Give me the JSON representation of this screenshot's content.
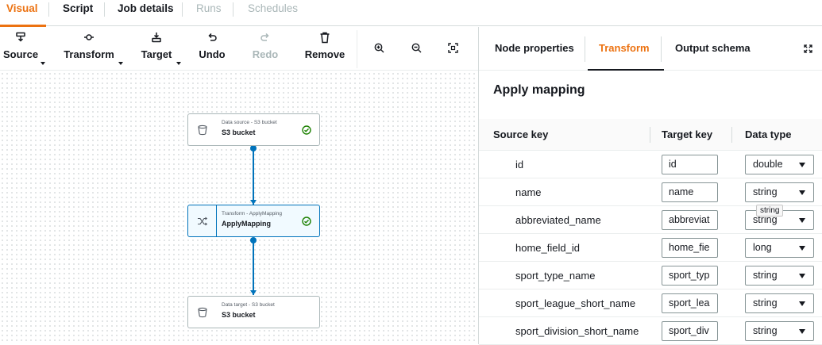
{
  "top_tabs": [
    {
      "label": "Visual"
    },
    {
      "label": "Script"
    },
    {
      "label": "Job details"
    },
    {
      "label": "Runs"
    },
    {
      "label": "Schedules"
    }
  ],
  "toolbar": {
    "source": "Source",
    "transform": "Transform",
    "target": "Target",
    "undo": "Undo",
    "redo": "Redo",
    "remove": "Remove"
  },
  "nodes": [
    {
      "subtitle": "Data source - S3 bucket",
      "title": "S3 bucket",
      "status": "success"
    },
    {
      "subtitle": "Transform - ApplyMapping",
      "title": "ApplyMapping",
      "status": "success"
    },
    {
      "subtitle": "Data target - S3 bucket",
      "title": "S3 bucket"
    }
  ],
  "panel": {
    "tabs": [
      {
        "label": "Node properties"
      },
      {
        "label": "Transform"
      },
      {
        "label": "Output schema"
      }
    ],
    "title": "Apply mapping",
    "columns": {
      "source_key": "Source key",
      "target_key": "Target key",
      "data_type": "Data type"
    },
    "rows": [
      {
        "source": "id",
        "target": "id",
        "type": "double"
      },
      {
        "source": "name",
        "target": "name",
        "type": "string"
      },
      {
        "source": "abbreviated_name",
        "target": "abbreviat",
        "type": "string"
      },
      {
        "source": "home_field_id",
        "target": "home_fie",
        "type": "long"
      },
      {
        "source": "sport_type_name",
        "target": "sport_typ",
        "type": "string"
      },
      {
        "source": "sport_league_short_name",
        "target": "sport_lea",
        "type": "string"
      },
      {
        "source": "sport_division_short_name",
        "target": "sport_div",
        "type": "string"
      }
    ],
    "tooltip": "string"
  },
  "colors": {
    "accent": "#ec7211",
    "link": "#0073bb",
    "success": "#1d8102"
  }
}
